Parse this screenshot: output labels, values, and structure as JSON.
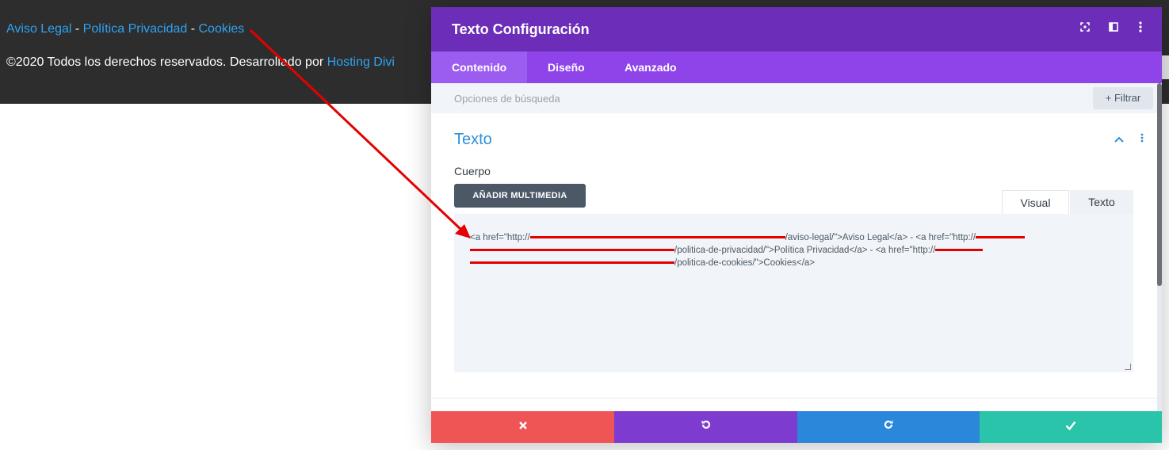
{
  "footer": {
    "links": [
      "Aviso Legal",
      "Política Privacidad",
      "Cookies"
    ],
    "separator": " - ",
    "copyright_prefix": "©2020 Todos los derechos reservados. Desarrollado por ",
    "copyright_link": "Hosting Divi"
  },
  "modal": {
    "title": "Texto Configuración",
    "header_icons": [
      "expand-icon",
      "split-view-icon",
      "more-vertical-icon"
    ],
    "tabs": [
      {
        "label": "Contenido",
        "active": true
      },
      {
        "label": "Diseño",
        "active": false
      },
      {
        "label": "Avanzado",
        "active": false
      }
    ],
    "search_placeholder": "Opciones de búsqueda",
    "filter_label": "+ Filtrar",
    "section": {
      "title": "Texto",
      "field_label": "Cuerpo",
      "media_button": "AÑADIR MULTIMEDIA",
      "editor_tabs": [
        "Visual",
        "Texto"
      ],
      "code_parts": [
        "<a href=\"http://",
        "/aviso-legal/\">Aviso Legal</a> - <a href=\"http://",
        "/politica-de-privacidad/\">Política Privacidad</a> - <a href=\"http://",
        "/politica-de-cookies/\">Cookies</a>"
      ]
    },
    "footer_buttons": [
      {
        "name": "cancel",
        "icon": "close-icon"
      },
      {
        "name": "undo",
        "icon": "undo-icon"
      },
      {
        "name": "redo",
        "icon": "redo-icon"
      },
      {
        "name": "save",
        "icon": "check-icon"
      }
    ]
  },
  "colors": {
    "header_purple": "#6c2eb9",
    "tab_purple": "#8e44e8",
    "link_blue": "#2ea3f2",
    "annotation_red": "#e40000"
  }
}
